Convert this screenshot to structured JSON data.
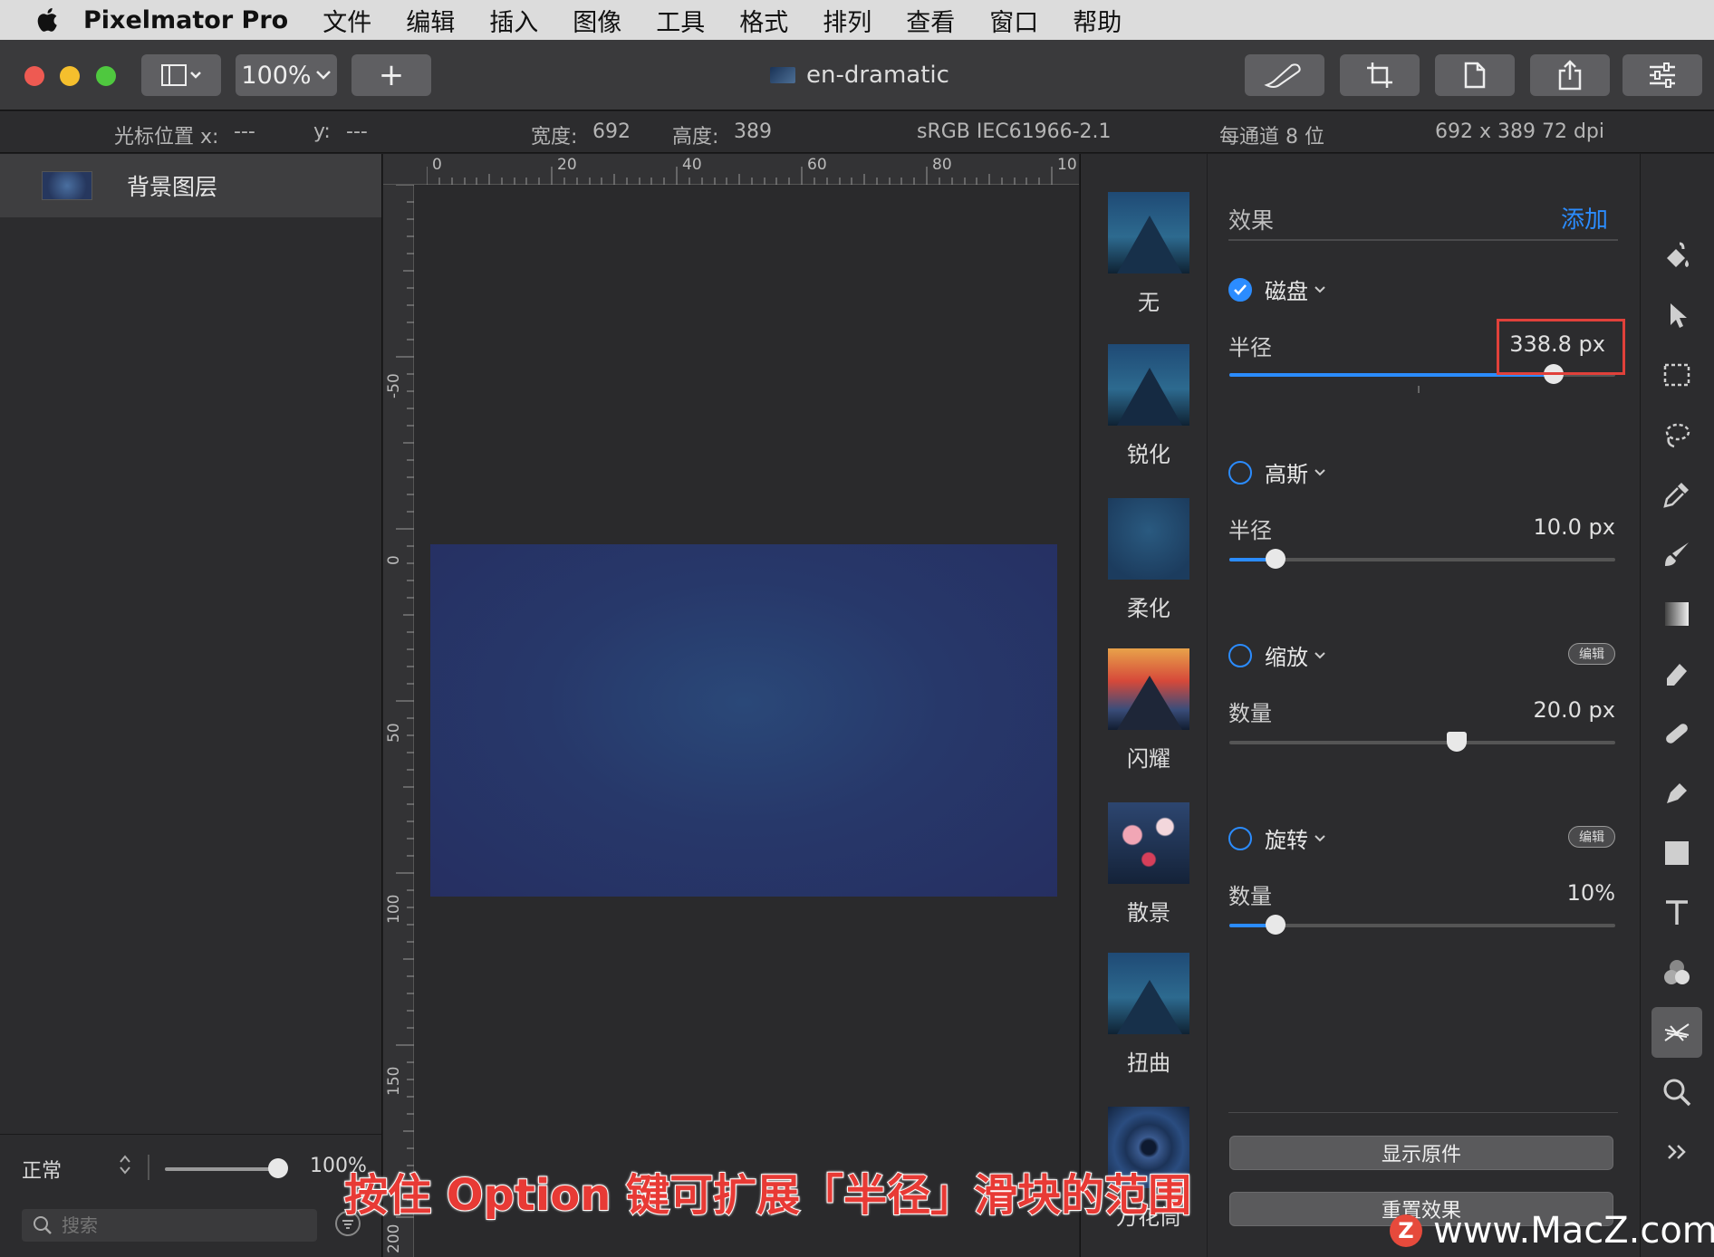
{
  "menubar": {
    "app_name": "Pixelmator Pro",
    "items": [
      "文件",
      "编辑",
      "插入",
      "图像",
      "工具",
      "格式",
      "排列",
      "查看",
      "窗口",
      "帮助"
    ]
  },
  "toolbar": {
    "zoom": "100%",
    "add": "+",
    "document_title": "en-dramatic"
  },
  "infobar": {
    "cursor_x_label": "光标位置 x:",
    "cursor_x_value": "---",
    "cursor_y_label": "y:",
    "cursor_y_value": "---",
    "width_label": "宽度:",
    "width_value": "692",
    "height_label": "高度:",
    "height_value": "389",
    "color_profile": "sRGB IEC61966-2.1",
    "bit_depth": "每通道 8 位",
    "size_dpi": "692 x 389 72 dpi"
  },
  "layers": {
    "layer_name": "背景图层",
    "blend_mode": "正常",
    "opacity": "100%",
    "search_placeholder": "搜索"
  },
  "rulers": {
    "horizontal": [
      "0",
      "20",
      "40",
      "60",
      "80",
      "10"
    ],
    "vertical": [
      "-50",
      "0",
      "50",
      "100",
      "150",
      "200"
    ]
  },
  "presets": [
    {
      "label": "无"
    },
    {
      "label": "锐化"
    },
    {
      "label": "柔化"
    },
    {
      "label": "闪耀"
    },
    {
      "label": "散景"
    },
    {
      "label": "扭曲"
    },
    {
      "label": "万花筒"
    }
  ],
  "effects": {
    "title": "效果",
    "add_label": "添加",
    "items": [
      {
        "name": "磁盘",
        "enabled": true,
        "param_label": "半径",
        "param_value": "338.8 px",
        "level": 0.84
      },
      {
        "name": "高斯",
        "enabled": false,
        "param_label": "半径",
        "param_value": "10.0 px",
        "level": 0.12
      },
      {
        "name": "缩放",
        "enabled": false,
        "edit_label": "编辑",
        "param_label": "数量",
        "param_value": "20.0 px",
        "level": 0.59
      },
      {
        "name": "旋转",
        "enabled": false,
        "edit_label": "编辑",
        "param_label": "数量",
        "param_value": "10%",
        "level": 0.12
      }
    ],
    "show_original": "显示原件",
    "reset_effects": "重置效果"
  },
  "tools": [
    "paint-bucket-icon",
    "arrow-icon",
    "marquee-icon",
    "lasso-icon",
    "color-picker-icon",
    "brush-icon",
    "gradient-icon",
    "eraser-icon",
    "bandage-icon",
    "pen-icon",
    "shape-icon",
    "text-icon",
    "color-adjust-icon",
    "effects-icon",
    "zoom-icon",
    "more-icon"
  ],
  "caption": "按住 Option 键可扩展「半径」滑块的范围",
  "watermark": "www.MacZ.com",
  "colors": {
    "accent": "#2b8cff",
    "highlight": "#e0413a"
  }
}
